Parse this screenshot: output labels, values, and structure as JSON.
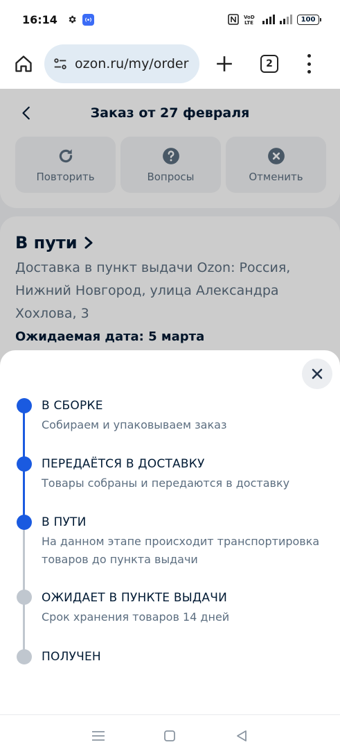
{
  "status_bar": {
    "time": "16:14",
    "battery": "100"
  },
  "browser": {
    "url": "ozon.ru/my/order",
    "tab_count": "2"
  },
  "order_page": {
    "title": "Заказ от 27 февраля",
    "actions": [
      {
        "label": "Повторить",
        "icon": "repeat-icon"
      },
      {
        "label": "Вопросы",
        "icon": "question-icon"
      },
      {
        "label": "Отменить",
        "icon": "cancel-icon"
      }
    ],
    "status_title": "В пути",
    "address": "Доставка в пункт выдачи Ozon: Россия, Нижний Новгород, улица Александра Хохлова, 3",
    "expected_date": "Ожидаемая дата: 5 марта"
  },
  "sheet": {
    "steps": [
      {
        "title": "В СБОРКЕ",
        "desc": "Собираем и упаковываем заказ",
        "done": true
      },
      {
        "title": "ПЕРЕДАЁТСЯ В ДОСТАВКУ",
        "desc": "Товары собраны и передаются в доставку",
        "done": true
      },
      {
        "title": "В ПУТИ",
        "desc": "На данном этапе происходит транспортировка товаров до пункта выдачи",
        "done": true
      },
      {
        "title": "ОЖИДАЕТ В ПУНКТЕ ВЫДАЧИ",
        "desc": "Срок хранения товаров 14 дней",
        "done": false
      },
      {
        "title": "ПОЛУЧЕН",
        "desc": "",
        "done": false
      }
    ],
    "colors": {
      "active": "#1a5ae0",
      "inactive": "#c0c7cf"
    }
  }
}
